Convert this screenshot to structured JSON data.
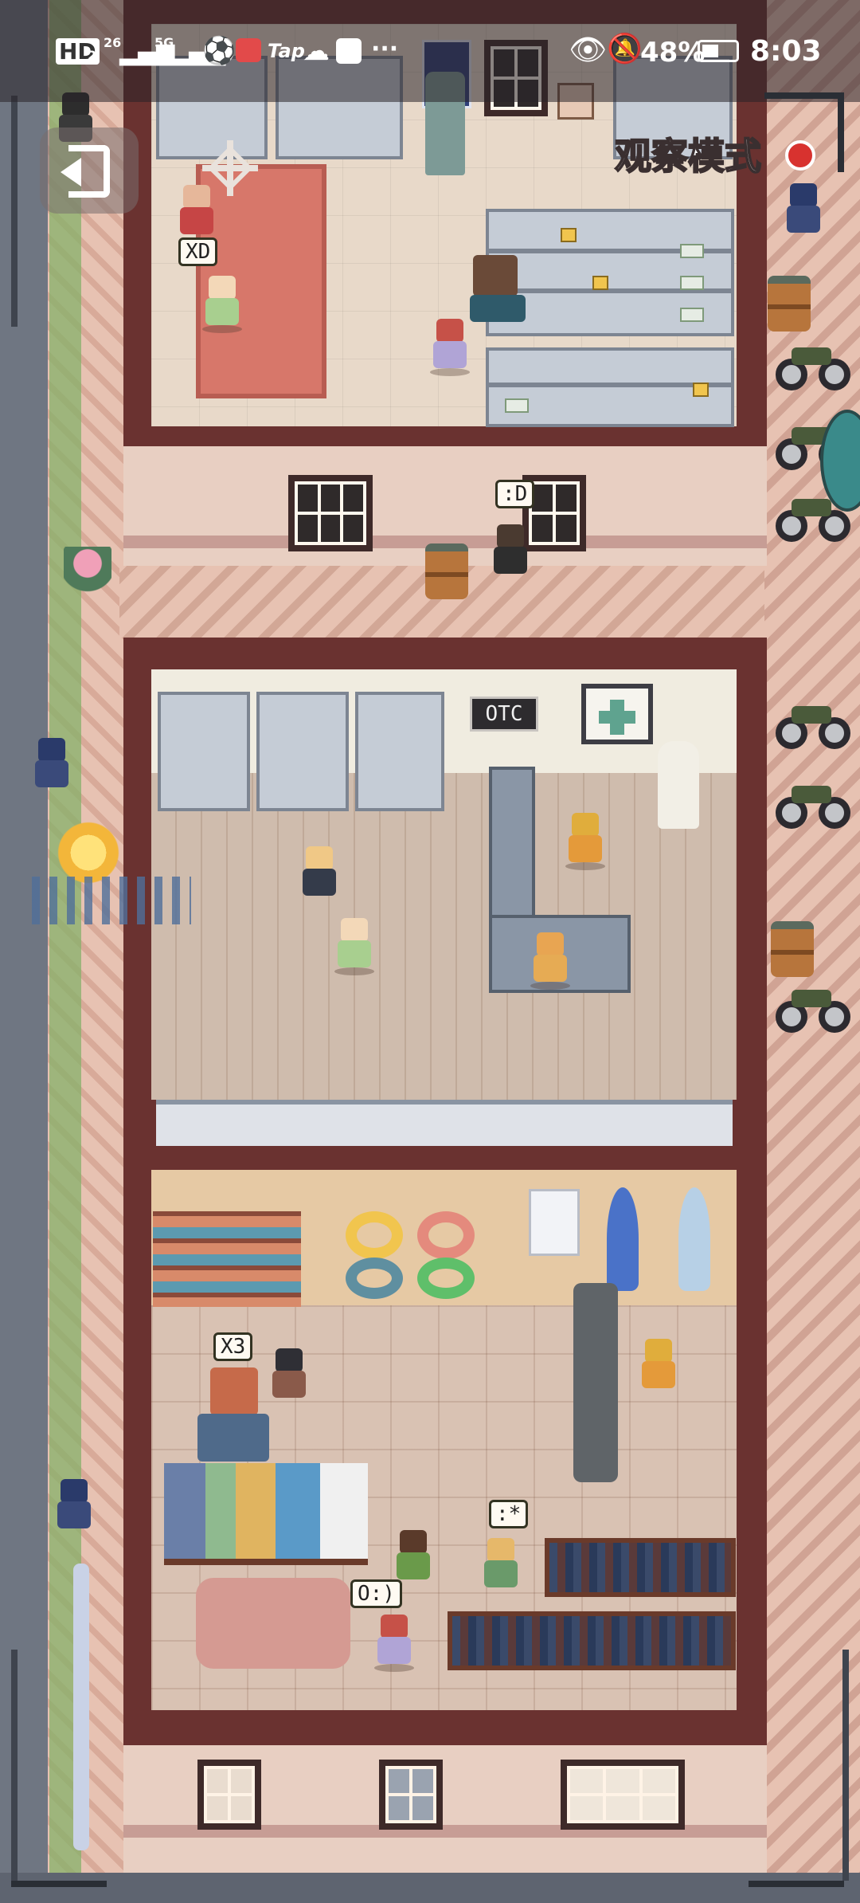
{
  "status_bar": {
    "left_icons": [
      "HD",
      "2",
      "26",
      "5G"
    ],
    "app_icons": [
      "soccer-icon",
      "book-icon",
      "cloud-icon",
      "bag-icon"
    ],
    "tap_label": "Tap",
    "more": "···",
    "battery_percent": "48%",
    "time": "8:03"
  },
  "hud": {
    "mode_label": "观察模式",
    "back_icon": "exit-door-icon",
    "target_icon": "crosshair-icon",
    "record_icon": "red-dot-icon"
  },
  "pharmacy": {
    "sign": "OTC",
    "cross_icon": "green-cross-icon"
  },
  "speech_bubbles": {
    "xd": "XD",
    "happy": ":D",
    "x3": "X3",
    "kiss": ":*",
    "surprised": "O:)"
  },
  "colors": {
    "wall": "#6a3230",
    "floor_wood": "#cfbcad",
    "floor_tile": "#d9c2b3",
    "sidewalk": "#e7c2b2",
    "road": "#6f7682"
  }
}
